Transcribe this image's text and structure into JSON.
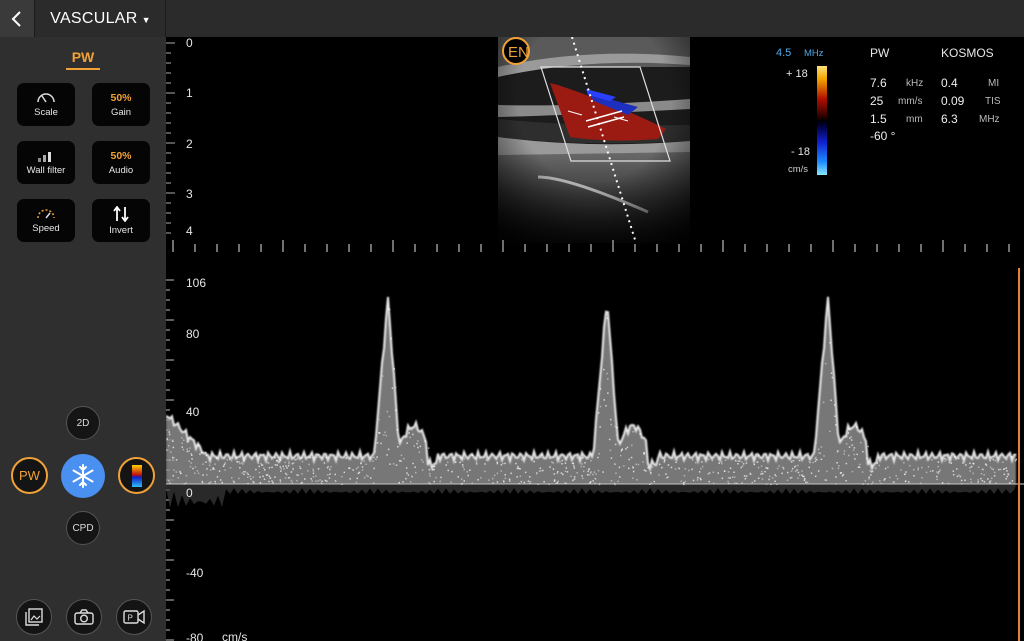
{
  "header": {
    "preset": "VASCULAR"
  },
  "sidebar": {
    "mode_label": "PW",
    "tiles": [
      {
        "label": "Scale",
        "value": ""
      },
      {
        "label": "Gain",
        "value": "50%"
      },
      {
        "label": "Wall filter",
        "value": ""
      },
      {
        "label": "Audio",
        "value": "50%"
      },
      {
        "label": "Speed",
        "value": ""
      },
      {
        "label": "Invert",
        "value": ""
      }
    ],
    "mode_buttons": {
      "two_d": "2D",
      "pw": "PW",
      "cpd": "CPD"
    }
  },
  "depth_scale": [
    "0",
    "1",
    "2",
    "3",
    "4"
  ],
  "color_bar": {
    "freq_value": "4.5",
    "freq_unit": "MHz",
    "top": "+ 18",
    "bottom": "- 18",
    "unit": "cm/s"
  },
  "params": {
    "mode": "PW",
    "brand": "KOSMOS",
    "rows": [
      {
        "v1": "7.6",
        "u1": "kHz",
        "v2": "0.4",
        "u2": "MI"
      },
      {
        "v1": "25",
        "u1": "mm/s",
        "v2": "0.09",
        "u2": "TIS"
      },
      {
        "v1": "1.5",
        "u1": "mm",
        "v2": "6.3",
        "u2": "MHz"
      }
    ],
    "angle": "-60 °"
  },
  "doppler_scale": {
    "top": "106",
    "t80": "80",
    "t40": "40",
    "zero": "0",
    "tneg40": "-40",
    "bottom": "-80",
    "unit": "cm/s"
  },
  "colors": {
    "accent": "#f0a238",
    "freeze": "#4a90f0",
    "panel": "#2f2f2f",
    "topbar": "#2b2b2b",
    "spectrum": "#ffffff"
  },
  "icons": [
    "chevron-left-icon",
    "caret-down-icon",
    "scale-gauge-icon",
    "wall-filter-bars-icon",
    "speed-gauge-icon",
    "invert-arrows-icon",
    "snowflake-icon",
    "color-gradient-icon",
    "gallery-icon",
    "camera-icon",
    "video-record-icon"
  ]
}
